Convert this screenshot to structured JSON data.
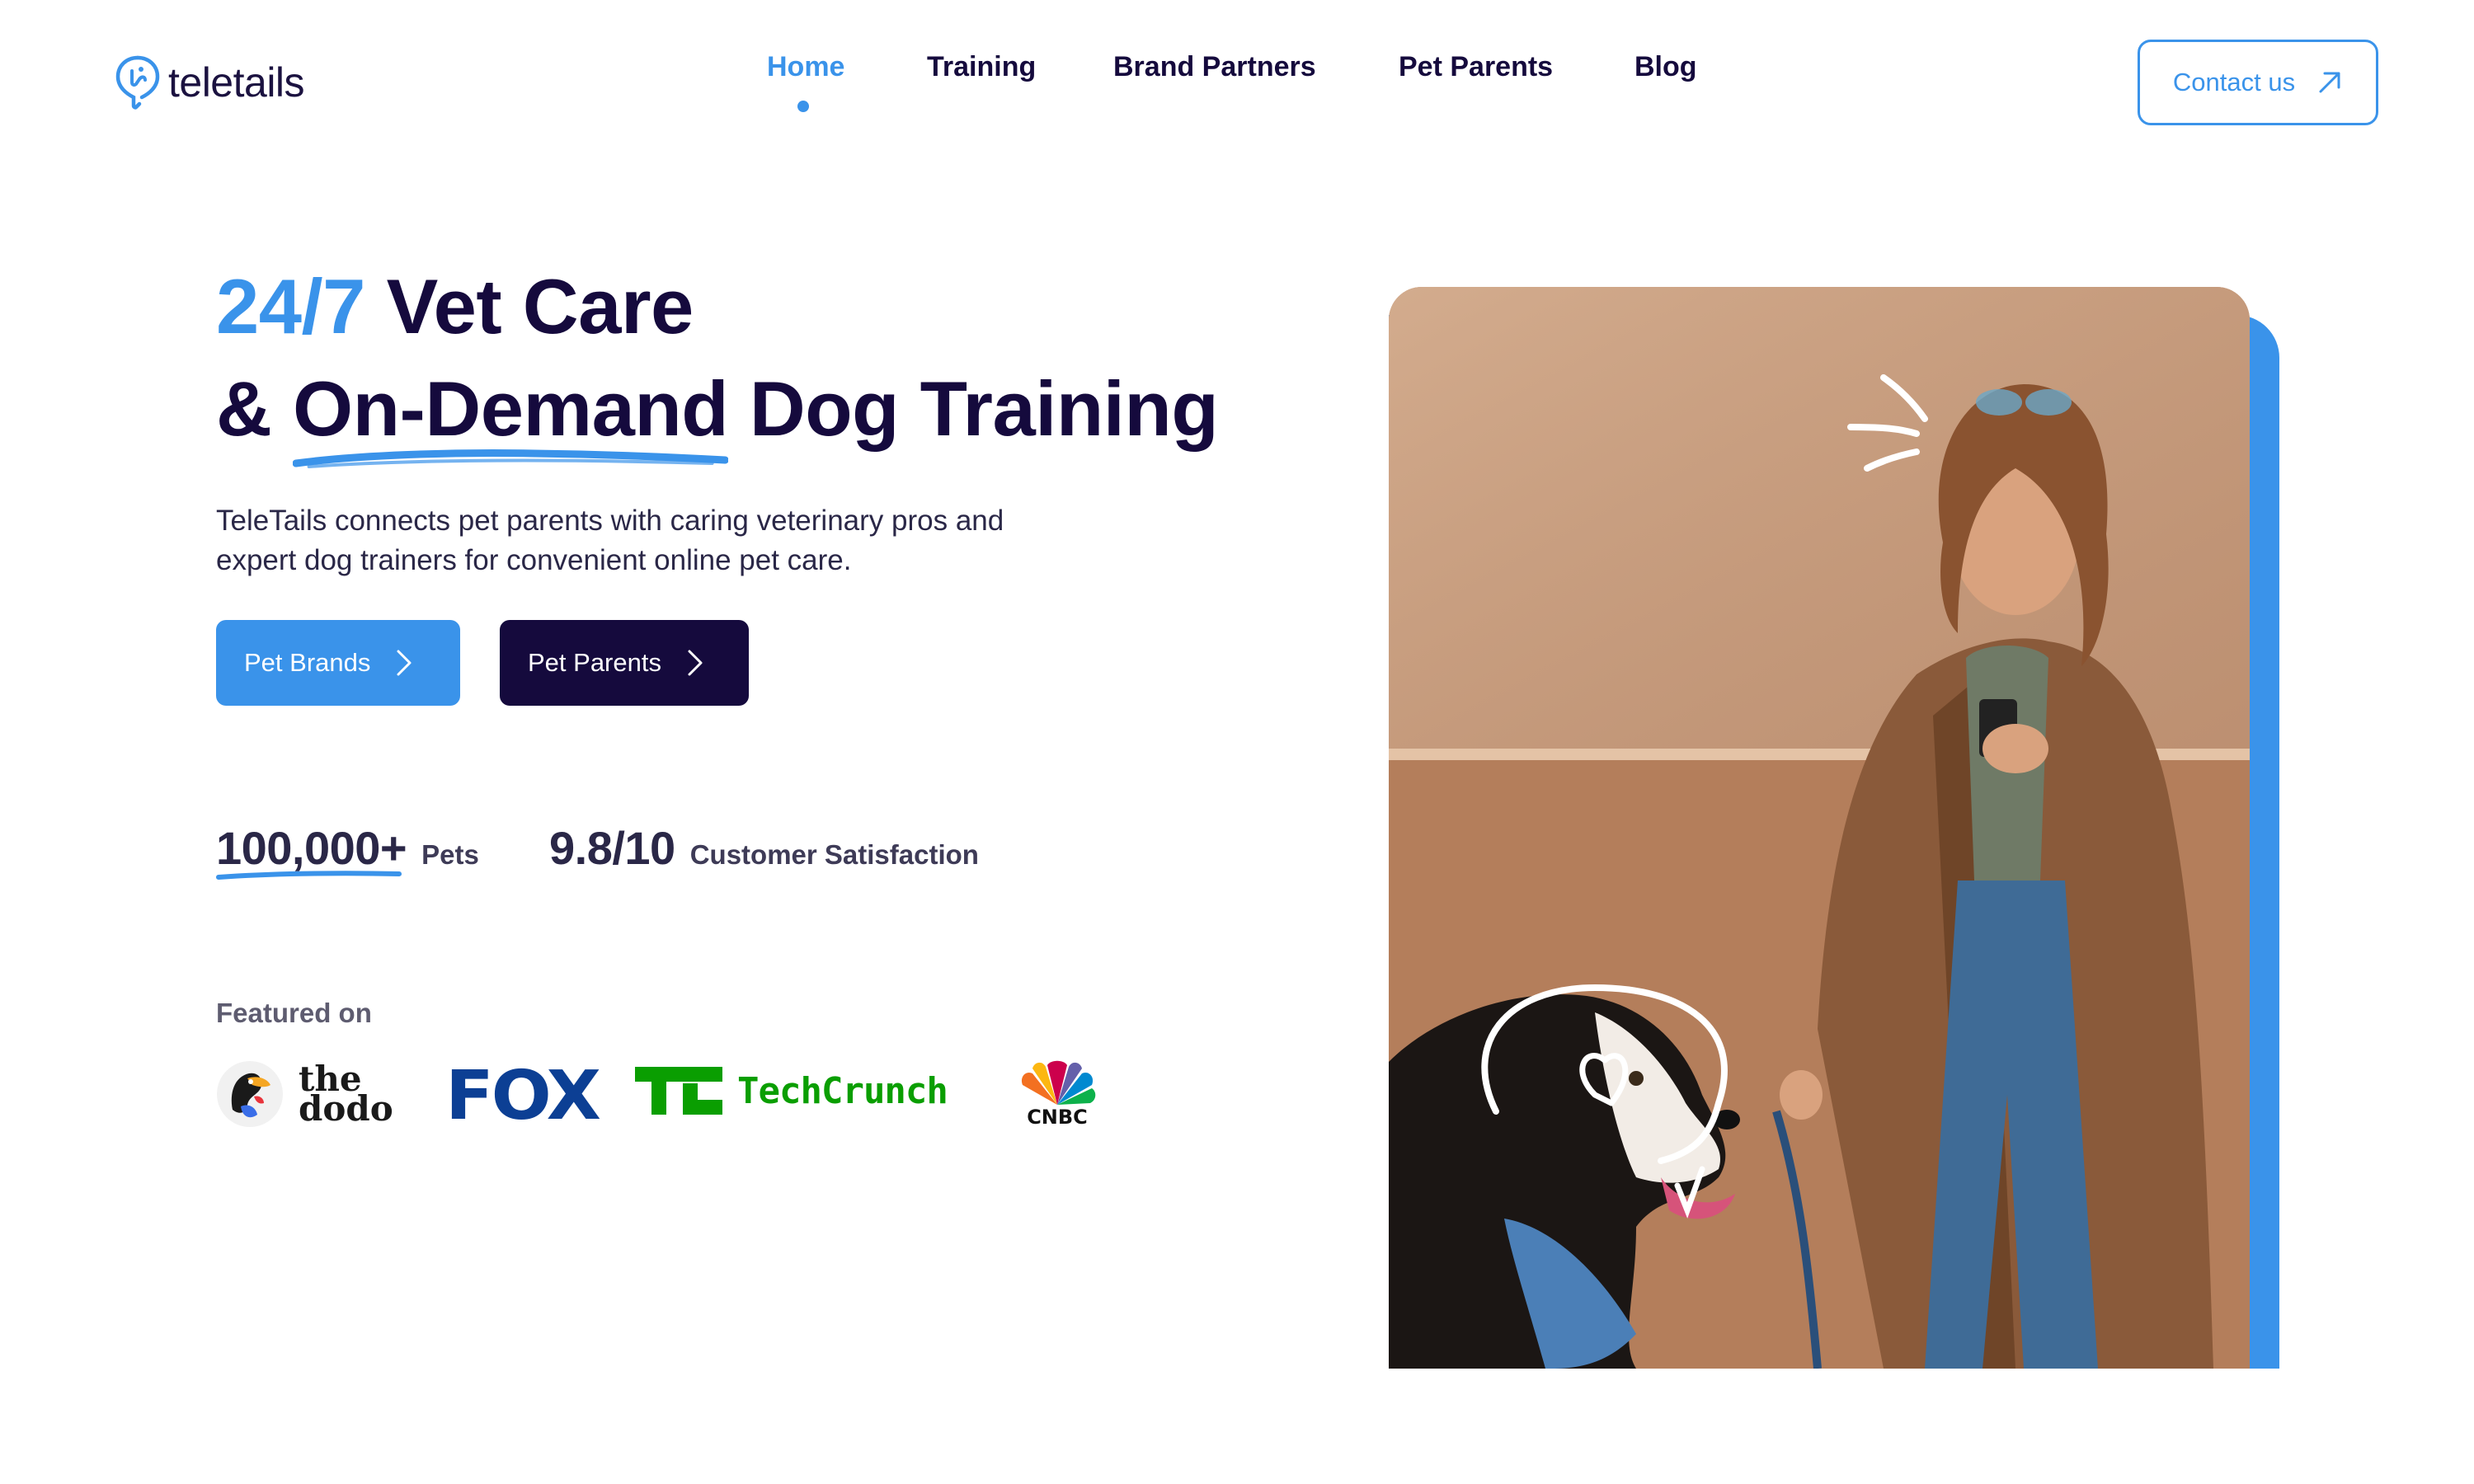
{
  "brand": {
    "name": "teletails"
  },
  "nav": {
    "items": [
      "Home",
      "Training",
      "Brand Partners",
      "Pet Parents",
      "Blog"
    ],
    "active": "Home"
  },
  "contact": {
    "label": "Contact us"
  },
  "hero": {
    "headline_accent": "24/7",
    "headline_rest": " Vet Care",
    "line2_prefix": "& ",
    "line2_underlined": "On-Demand",
    "line2_suffix": " Dog Training",
    "description": "TeleTails connects pet parents with caring veterinary pros and expert dog trainers for convenient online pet care.",
    "buttons": {
      "brands": "Pet Brands",
      "parents": "Pet Parents"
    }
  },
  "stats": [
    {
      "value": "100,000+",
      "label": "Pets"
    },
    {
      "value": "9.8/10",
      "label": "Customer Satisfaction"
    }
  ],
  "featured": {
    "label": "Featured on",
    "logos": {
      "dodo_line1": "the",
      "dodo_line2": "dodo",
      "fox": "FOX",
      "techcrunch": "TechCrunch",
      "cnbc": "CNBC"
    }
  },
  "colors": {
    "accent": "#3a93ea",
    "navy": "#150a3d",
    "fox_blue": "#0c3f94",
    "techcrunch_green": "#0a9e01"
  },
  "icons": {
    "logo": "paw-pin-icon",
    "contact": "arrow-up-right-icon",
    "buttons": "chevron-right-icon"
  }
}
